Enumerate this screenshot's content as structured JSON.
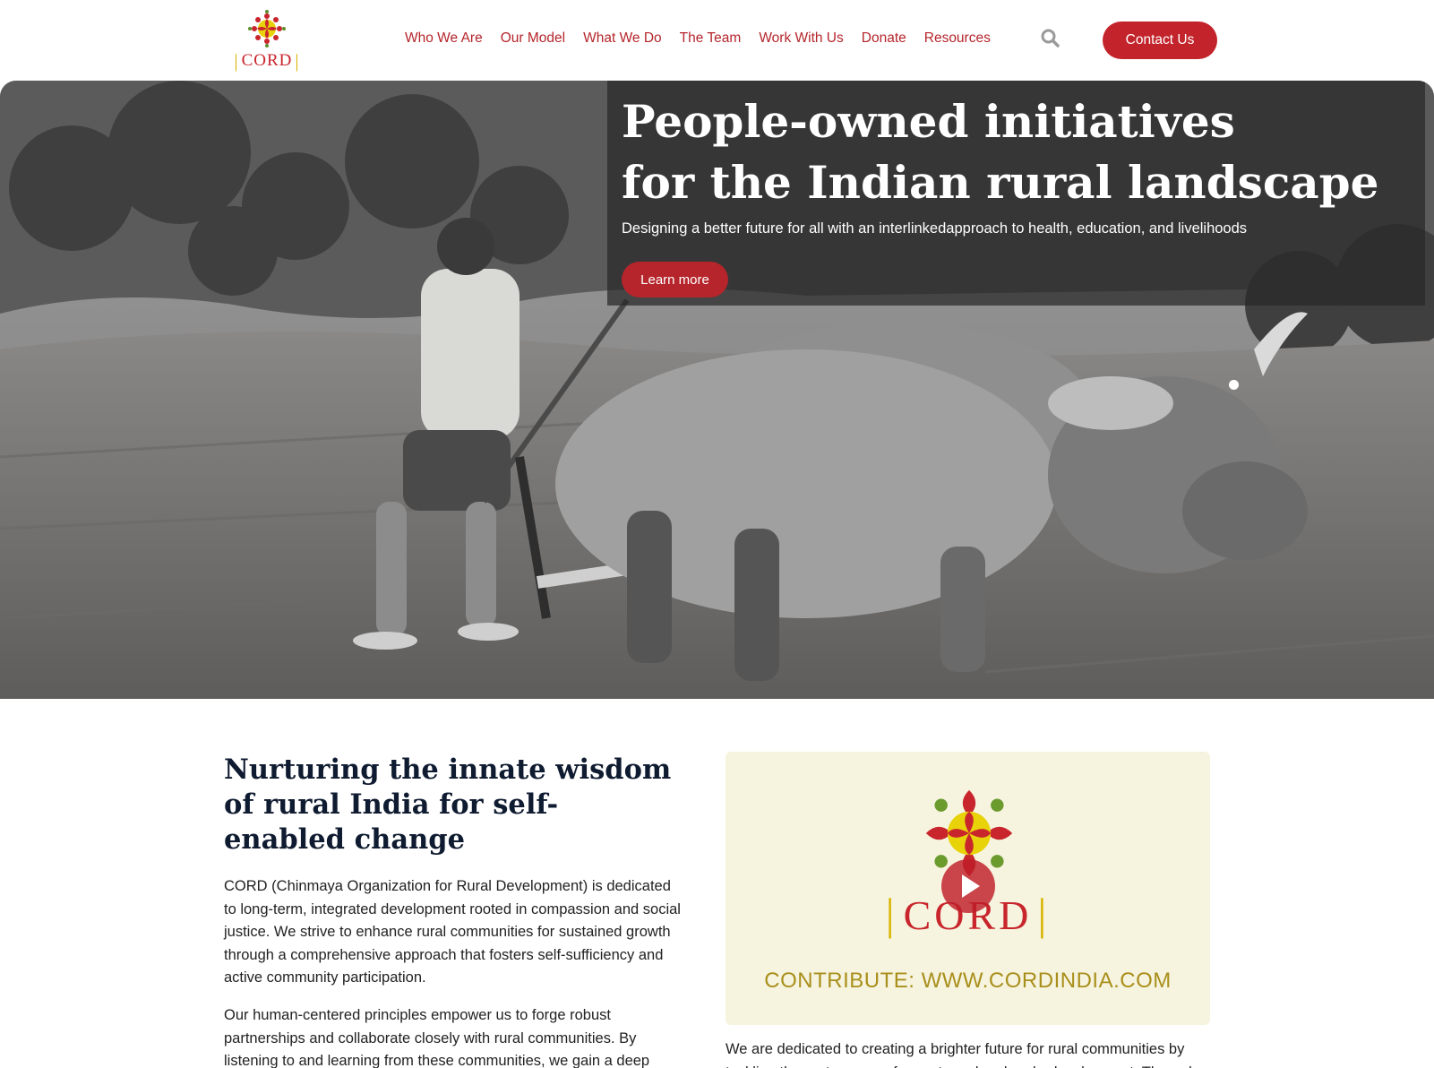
{
  "brand": {
    "logo_text": "CORD"
  },
  "nav": {
    "items": [
      "Who We Are",
      "Our Model",
      "What We Do",
      "The Team",
      "Work With Us",
      "Donate",
      "Resources"
    ],
    "search_icon": "search-icon",
    "contact_label": "Contact Us"
  },
  "hero": {
    "title_line1": "People-owned initiatives",
    "title_line2": "for the Indian rural landscape",
    "subtitle": "Designing a better future for all with an interlinkedapproach to health, education, and livelihoods",
    "cta_label": "Learn more"
  },
  "about": {
    "title_line1": "Nurturing the innate wisdom",
    "title_line2": "of rural India for self-",
    "title_line3": "enabled change",
    "para1": "CORD (Chinmaya Organization for Rural Development) is dedicated to long-term, integrated development rooted in compassion and social justice. We strive to enhance rural communities for sustained growth through a comprehensive approach that fosters self-sufficiency and active community participation.",
    "para2": "Our human-centered principles empower us to forge robust partnerships and collaborate closely with rural communities. By listening to and learning from these communities, we gain a deep"
  },
  "video": {
    "logo_text": "CORD",
    "caption": "CONTRIBUTE: WWW.CORDINDIA.COM",
    "play_icon": "play-icon"
  },
  "right_text": "We are dedicated to creating a brighter future for rural communities by tackling the root causes of poverty and and underdevelopment. Through",
  "colors": {
    "accent": "#c3242b",
    "heading": "#0f1b30",
    "gold": "#d8b400"
  }
}
